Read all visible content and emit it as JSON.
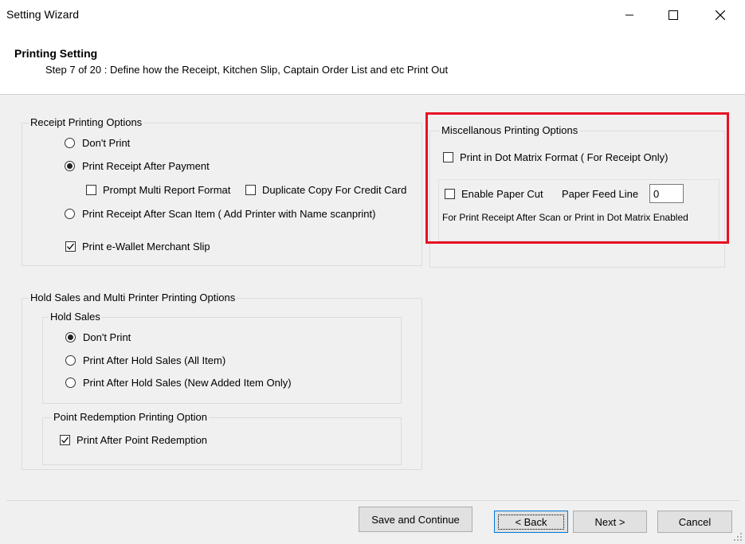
{
  "window": {
    "title": "Setting Wizard",
    "controls": {
      "minimize": "minimize",
      "maximize": "maximize",
      "close": "close"
    }
  },
  "header": {
    "title": "Printing Setting",
    "subtitle": "Step 7 of 20 : Define how the Receipt, Kitchen Slip, Captain Order List and etc Print Out"
  },
  "receipt_options": {
    "label": "Receipt Printing Options",
    "dont_print": {
      "label": "Don't Print",
      "selected": false
    },
    "after_payment": {
      "label": "Print Receipt After Payment",
      "selected": true
    },
    "prompt_multi_report": {
      "label": "Prompt Multi Report Format",
      "checked": false
    },
    "duplicate_copy": {
      "label": "Duplicate Copy For Credit Card",
      "checked": false
    },
    "after_scan_item": {
      "label": "Print Receipt After Scan Item ( Add Printer with Name scanprint)",
      "selected": false
    },
    "ewallet_slip": {
      "label": "Print e-Wallet Merchant Slip",
      "checked": true
    }
  },
  "misc_options": {
    "label": "Miscellanous Printing Options",
    "dot_matrix": {
      "label": "Print in Dot Matrix Format ( For Receipt Only)",
      "checked": false
    },
    "paper_cut": {
      "label": "Enable Paper Cut",
      "checked": false
    },
    "paper_feed_label": "Paper Feed Line",
    "paper_feed_value": "0",
    "note": "For Print Receipt After Scan or Print in Dot Matrix Enabled"
  },
  "hold_sales_options": {
    "label": "Hold Sales and Multi Printer Printing Options",
    "hold_sales": {
      "label": "Hold Sales",
      "dont_print": {
        "label": "Don't Print",
        "selected": true
      },
      "all_item": {
        "label": "Print After Hold Sales (All Item)",
        "selected": false
      },
      "new_item": {
        "label": "Print After Hold Sales (New Added Item Only)",
        "selected": false
      }
    },
    "point_redemption": {
      "label": "Point Redemption Printing Option",
      "after_redemption": {
        "label": "Print After Point Redemption",
        "checked": true
      }
    }
  },
  "footer": {
    "save_continue": "Save and Continue",
    "back": "< Back",
    "next": "Next >",
    "cancel": "Cancel"
  },
  "colors": {
    "highlight": "#e81123",
    "focus": "#0078d7"
  }
}
